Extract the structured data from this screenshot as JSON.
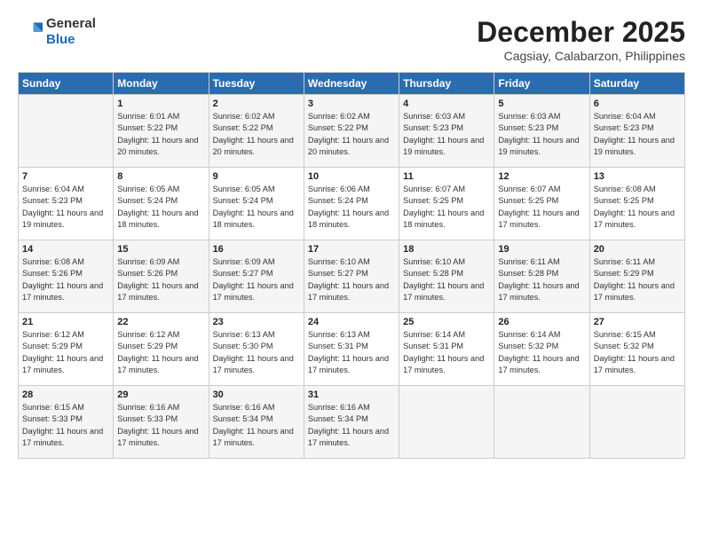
{
  "header": {
    "logo_line1": "General",
    "logo_line2": "Blue",
    "month": "December 2025",
    "location": "Cagsiay, Calabarzon, Philippines"
  },
  "days_of_week": [
    "Sunday",
    "Monday",
    "Tuesday",
    "Wednesday",
    "Thursday",
    "Friday",
    "Saturday"
  ],
  "weeks": [
    [
      {
        "day": "",
        "info": ""
      },
      {
        "day": "1",
        "info": "Sunrise: 6:01 AM\nSunset: 5:22 PM\nDaylight: 11 hours and 20 minutes."
      },
      {
        "day": "2",
        "info": "Sunrise: 6:02 AM\nSunset: 5:22 PM\nDaylight: 11 hours and 20 minutes."
      },
      {
        "day": "3",
        "info": "Sunrise: 6:02 AM\nSunset: 5:22 PM\nDaylight: 11 hours and 20 minutes."
      },
      {
        "day": "4",
        "info": "Sunrise: 6:03 AM\nSunset: 5:23 PM\nDaylight: 11 hours and 19 minutes."
      },
      {
        "day": "5",
        "info": "Sunrise: 6:03 AM\nSunset: 5:23 PM\nDaylight: 11 hours and 19 minutes."
      },
      {
        "day": "6",
        "info": "Sunrise: 6:04 AM\nSunset: 5:23 PM\nDaylight: 11 hours and 19 minutes."
      }
    ],
    [
      {
        "day": "7",
        "info": "Sunrise: 6:04 AM\nSunset: 5:23 PM\nDaylight: 11 hours and 19 minutes."
      },
      {
        "day": "8",
        "info": "Sunrise: 6:05 AM\nSunset: 5:24 PM\nDaylight: 11 hours and 18 minutes."
      },
      {
        "day": "9",
        "info": "Sunrise: 6:05 AM\nSunset: 5:24 PM\nDaylight: 11 hours and 18 minutes."
      },
      {
        "day": "10",
        "info": "Sunrise: 6:06 AM\nSunset: 5:24 PM\nDaylight: 11 hours and 18 minutes."
      },
      {
        "day": "11",
        "info": "Sunrise: 6:07 AM\nSunset: 5:25 PM\nDaylight: 11 hours and 18 minutes."
      },
      {
        "day": "12",
        "info": "Sunrise: 6:07 AM\nSunset: 5:25 PM\nDaylight: 11 hours and 17 minutes."
      },
      {
        "day": "13",
        "info": "Sunrise: 6:08 AM\nSunset: 5:25 PM\nDaylight: 11 hours and 17 minutes."
      }
    ],
    [
      {
        "day": "14",
        "info": "Sunrise: 6:08 AM\nSunset: 5:26 PM\nDaylight: 11 hours and 17 minutes."
      },
      {
        "day": "15",
        "info": "Sunrise: 6:09 AM\nSunset: 5:26 PM\nDaylight: 11 hours and 17 minutes."
      },
      {
        "day": "16",
        "info": "Sunrise: 6:09 AM\nSunset: 5:27 PM\nDaylight: 11 hours and 17 minutes."
      },
      {
        "day": "17",
        "info": "Sunrise: 6:10 AM\nSunset: 5:27 PM\nDaylight: 11 hours and 17 minutes."
      },
      {
        "day": "18",
        "info": "Sunrise: 6:10 AM\nSunset: 5:28 PM\nDaylight: 11 hours and 17 minutes."
      },
      {
        "day": "19",
        "info": "Sunrise: 6:11 AM\nSunset: 5:28 PM\nDaylight: 11 hours and 17 minutes."
      },
      {
        "day": "20",
        "info": "Sunrise: 6:11 AM\nSunset: 5:29 PM\nDaylight: 11 hours and 17 minutes."
      }
    ],
    [
      {
        "day": "21",
        "info": "Sunrise: 6:12 AM\nSunset: 5:29 PM\nDaylight: 11 hours and 17 minutes."
      },
      {
        "day": "22",
        "info": "Sunrise: 6:12 AM\nSunset: 5:29 PM\nDaylight: 11 hours and 17 minutes."
      },
      {
        "day": "23",
        "info": "Sunrise: 6:13 AM\nSunset: 5:30 PM\nDaylight: 11 hours and 17 minutes."
      },
      {
        "day": "24",
        "info": "Sunrise: 6:13 AM\nSunset: 5:31 PM\nDaylight: 11 hours and 17 minutes."
      },
      {
        "day": "25",
        "info": "Sunrise: 6:14 AM\nSunset: 5:31 PM\nDaylight: 11 hours and 17 minutes."
      },
      {
        "day": "26",
        "info": "Sunrise: 6:14 AM\nSunset: 5:32 PM\nDaylight: 11 hours and 17 minutes."
      },
      {
        "day": "27",
        "info": "Sunrise: 6:15 AM\nSunset: 5:32 PM\nDaylight: 11 hours and 17 minutes."
      }
    ],
    [
      {
        "day": "28",
        "info": "Sunrise: 6:15 AM\nSunset: 5:33 PM\nDaylight: 11 hours and 17 minutes."
      },
      {
        "day": "29",
        "info": "Sunrise: 6:16 AM\nSunset: 5:33 PM\nDaylight: 11 hours and 17 minutes."
      },
      {
        "day": "30",
        "info": "Sunrise: 6:16 AM\nSunset: 5:34 PM\nDaylight: 11 hours and 17 minutes."
      },
      {
        "day": "31",
        "info": "Sunrise: 6:16 AM\nSunset: 5:34 PM\nDaylight: 11 hours and 17 minutes."
      },
      {
        "day": "",
        "info": ""
      },
      {
        "day": "",
        "info": ""
      },
      {
        "day": "",
        "info": ""
      }
    ]
  ]
}
